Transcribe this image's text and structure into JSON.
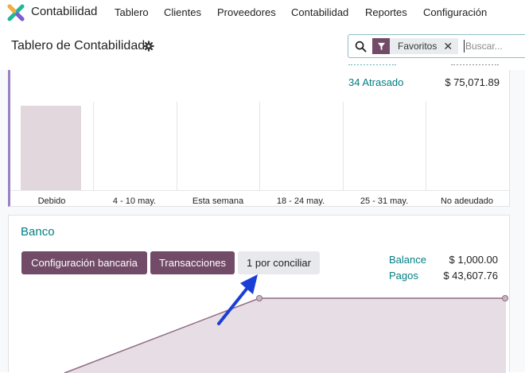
{
  "navbar": {
    "app_name": "Contabilidad",
    "menu": [
      "Tablero",
      "Clientes",
      "Proveedores",
      "Contabilidad",
      "Reportes",
      "Configuración"
    ]
  },
  "control_panel": {
    "title": "Tablero de Contabilidad",
    "search": {
      "facet_label": "Favoritos",
      "remove_glyph": "✕",
      "placeholder": "Buscar..."
    }
  },
  "receivables_card": {
    "stats": [
      {
        "label": "34 Atrasado",
        "value": "$ 75,071.89"
      }
    ],
    "partial_top_link": "",
    "chart_data": {
      "type": "bar",
      "categories": [
        "Debido",
        "4 - 10 may.",
        "Esta semana",
        "18 - 24 may.",
        "25 - 31 may.",
        "No adeudado"
      ],
      "values": [
        1,
        0,
        0,
        0,
        0,
        0
      ]
    }
  },
  "bank_card": {
    "title": "Banco",
    "buttons": {
      "bank_config": "Configuración bancaria",
      "transactions": "Transacciones",
      "reconcile": "1 por conciliar"
    },
    "stats": [
      {
        "label": "Balance",
        "value": "$ 1,000.00"
      },
      {
        "label": "Pagos",
        "value": "$ 43,607.76"
      }
    ]
  },
  "colors": {
    "brand": "#714b67",
    "link": "#017e84",
    "bar": "#e1d7dc",
    "line": "#8f6a86",
    "annotation_arrow": "#1a3fd6"
  }
}
